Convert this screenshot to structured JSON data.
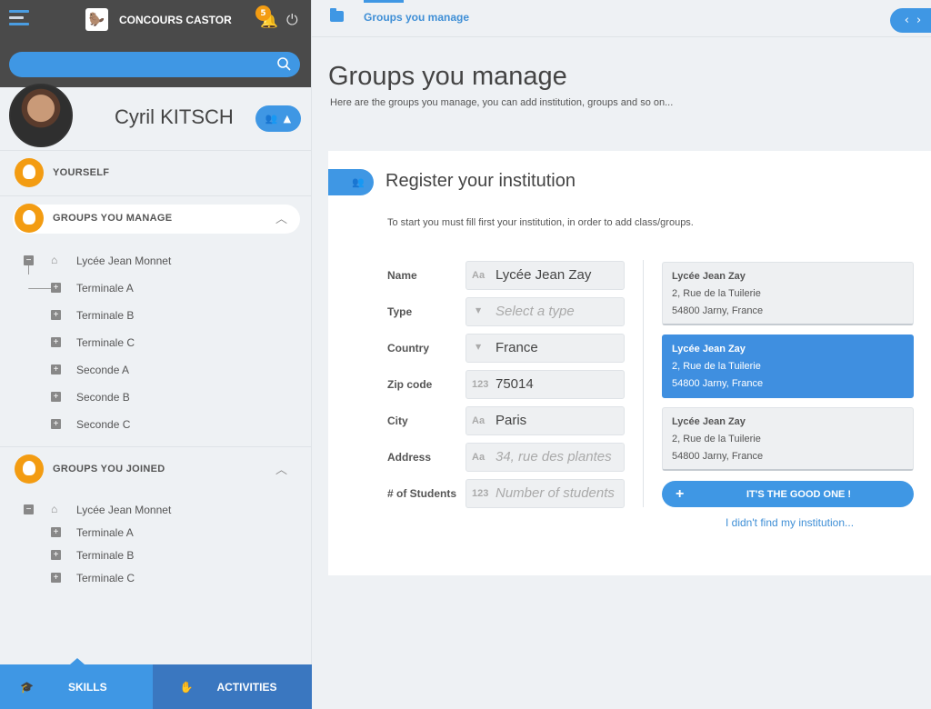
{
  "app": {
    "title": "CONCOURS CASTOR",
    "notification_count": "5"
  },
  "user": {
    "name": "Cyril KITSCH"
  },
  "sidebar": {
    "sections": [
      {
        "label": "YOURSELF"
      },
      {
        "label": "GROUPS YOU MANAGE"
      },
      {
        "label": "GROUPS YOU JOINED"
      }
    ],
    "managed_tree": {
      "root": "Lycée Jean Monnet",
      "children": [
        "Terminale A",
        "Terminale B",
        "Terminale C",
        "Seconde A",
        "Seconde B",
        "Seconde C"
      ]
    },
    "joined_tree": {
      "root": "Lycée Jean Monnet",
      "children": [
        "Terminale A",
        "Terminale B",
        "Terminale C"
      ]
    },
    "bottom_tabs": [
      {
        "label": "SKILLS"
      },
      {
        "label": "ACTIVITIES"
      }
    ]
  },
  "breadcrumb": {
    "label": "Groups you manage"
  },
  "page": {
    "title": "Groups you manage",
    "subtitle": "Here are the groups you manage, you can add institution, groups and so on..."
  },
  "card": {
    "title": "Register your institution",
    "intro": "To start you must fill first your institution, in order to add class/groups."
  },
  "form": {
    "fields": [
      {
        "label": "Name",
        "prefix": "Aa",
        "value": "Lycée Jean Zay",
        "placeholder": ""
      },
      {
        "label": "Type",
        "prefix": "▼",
        "value": "",
        "placeholder": "Select a type"
      },
      {
        "label": "Country",
        "prefix": "▼",
        "value": "France",
        "placeholder": ""
      },
      {
        "label": "Zip code",
        "prefix": "123",
        "value": "75014",
        "placeholder": ""
      },
      {
        "label": "City",
        "prefix": "Aa",
        "value": "Paris",
        "placeholder": ""
      },
      {
        "label": "Address",
        "prefix": "Aa",
        "value": "",
        "placeholder": "34, rue des plantes"
      },
      {
        "label": "# of Students",
        "prefix": "123",
        "value": "",
        "placeholder": "Number of students"
      }
    ]
  },
  "institutions": [
    {
      "name": "Lycée Jean Zay",
      "street": "2, Rue de la Tuilerie",
      "city": "54800 Jarny, France",
      "selected": false
    },
    {
      "name": "Lycée Jean Zay",
      "street": "2, Rue de la Tuilerie",
      "city": "54800 Jarny, France",
      "selected": true
    },
    {
      "name": "Lycée Jean Zay",
      "street": "2, Rue de la Tuilerie",
      "city": "54800 Jarny, France",
      "selected": false
    }
  ],
  "actions": {
    "confirm_label": "IT'S THE GOOD ONE !",
    "not_found_label": "I didn't find my institution..."
  },
  "colors": {
    "accent": "#3f97e4",
    "dark_bar": "#4a4a4a",
    "badge": "#f39c12"
  }
}
